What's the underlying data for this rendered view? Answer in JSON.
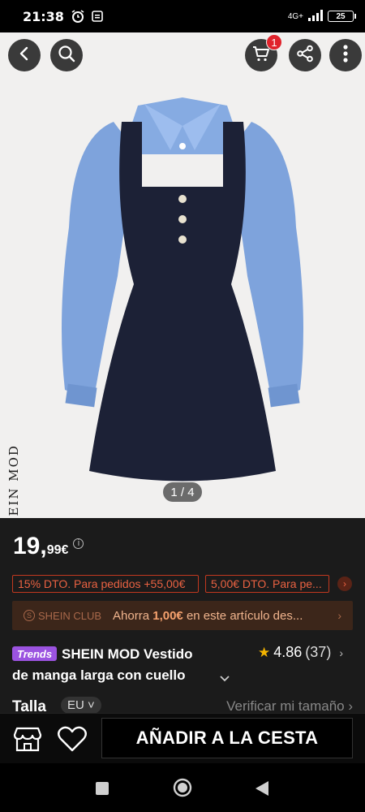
{
  "status_bar": {
    "time": "21:38",
    "network": "4G+",
    "battery": "25"
  },
  "top_bar": {
    "back_icon": "chevron-left-icon",
    "search_icon": "search-icon",
    "cart_icon": "cart-icon",
    "cart_badge": "1",
    "share_icon": "share-icon",
    "more_icon": "more-vertical-icon"
  },
  "product_image": {
    "brand_watermark": "SHEIN MOD",
    "pager": "1 / 4"
  },
  "price": {
    "integer": "19,",
    "decimal": "99€"
  },
  "coupons": [
    {
      "label": "15% DTO. Para pedidos +55,00€"
    },
    {
      "label": "5,00€ DTO. Para pe..."
    }
  ],
  "club": {
    "tag": "SHEIN CLUB",
    "text_before": "Ahorra ",
    "amount": "1,00€",
    "text_after": " en este artículo des..."
  },
  "product": {
    "trends_badge": "Trends",
    "title_line1": "SHEIN MOD Vestido",
    "title_line2": "de manga larga con cuello",
    "rating": "4.86",
    "reviews": "(37)"
  },
  "size": {
    "label": "Talla",
    "region": "EU",
    "verify": "Verificar mi tamaño"
  },
  "actions": {
    "add_to_cart": "AÑADIR A LA CESTA"
  },
  "colors": {
    "coupon_red": "#ea6242",
    "club_bg": "#3c261a",
    "trends_purple": "#9b53e0",
    "star": "#f4b400"
  }
}
